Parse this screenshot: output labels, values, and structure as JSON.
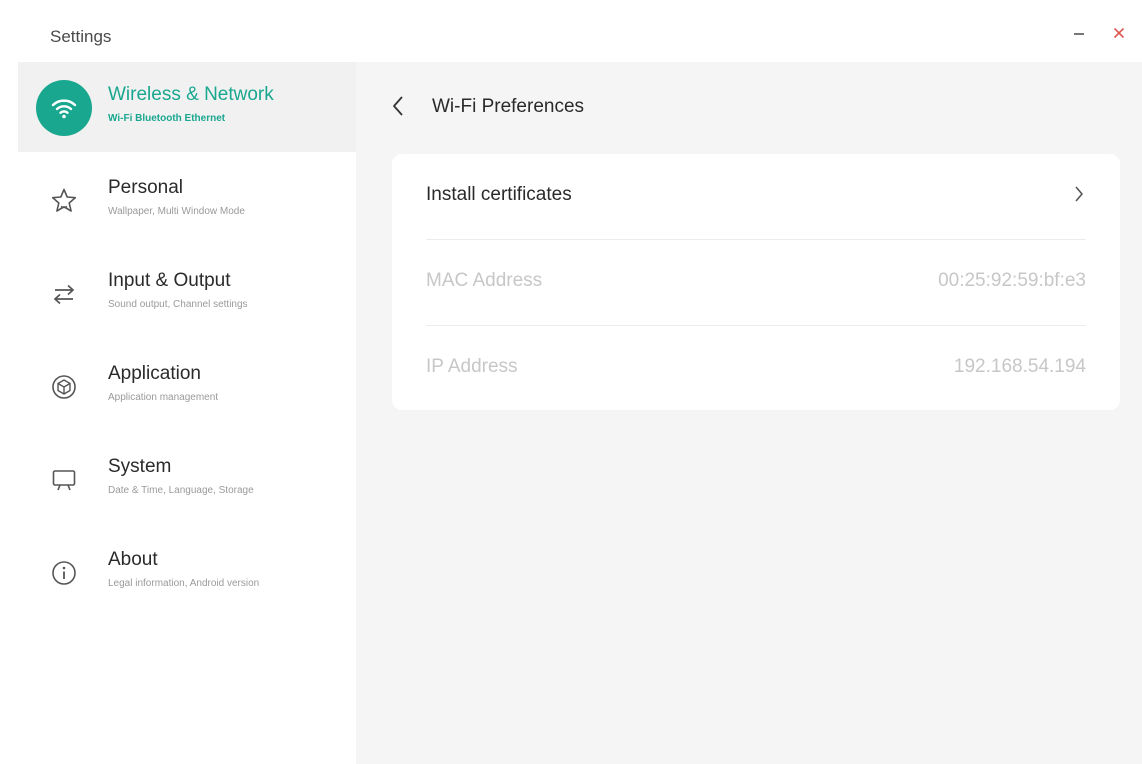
{
  "window": {
    "title": "Settings",
    "minimize_icon": "minimize-icon",
    "close_icon": "close-icon",
    "close_color": "#e0584f"
  },
  "colors": {
    "accent": "#1aa78f",
    "content_background": "#f5f5f5",
    "active_nav_background": "#f1f1f1",
    "disabled_text": "#c7c7c7"
  },
  "sidebar": {
    "items": [
      {
        "title": "Wireless & Network",
        "subtitle": "Wi-Fi Bluetooth Ethernet",
        "icon": "wifi-icon",
        "active": true
      },
      {
        "title": "Personal",
        "subtitle": "Wallpaper, Multi Window Mode",
        "icon": "star-icon",
        "active": false
      },
      {
        "title": "Input & Output",
        "subtitle": "Sound output, Channel settings",
        "icon": "swap-arrows-icon",
        "active": false
      },
      {
        "title": "Application",
        "subtitle": "Application management",
        "icon": "app-hexagon-icon",
        "active": false
      },
      {
        "title": "System",
        "subtitle": "Date & Time, Language, Storage",
        "icon": "monitor-icon",
        "active": false
      },
      {
        "title": "About",
        "subtitle": "Legal information, Android version",
        "icon": "info-icon",
        "active": false
      }
    ]
  },
  "main": {
    "back_icon": "chevron-left-icon",
    "title": "Wi-Fi Preferences",
    "rows": [
      {
        "label": "Install certificates",
        "value": "",
        "icon": "chevron-right-icon",
        "enabled": true
      },
      {
        "label": "MAC Address",
        "value": "00:25:92:59:bf:e3",
        "enabled": false
      },
      {
        "label": "IP Address",
        "value": "192.168.54.194",
        "enabled": false
      }
    ]
  }
}
